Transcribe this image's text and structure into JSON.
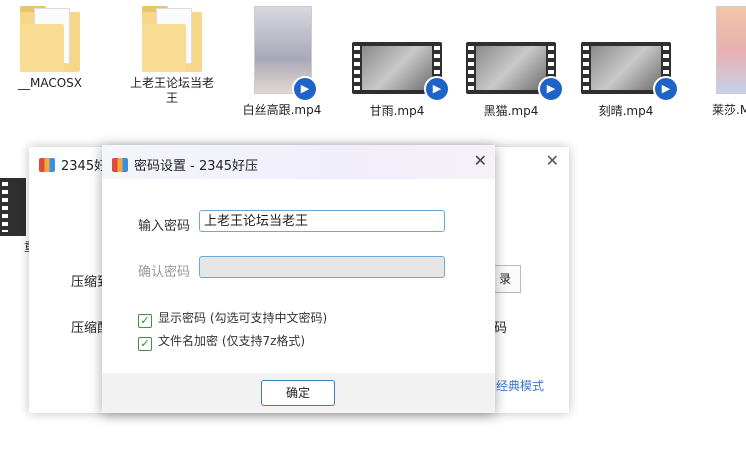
{
  "desktop": {
    "files": [
      {
        "name": "__MACOSX",
        "type": "folder"
      },
      {
        "name": "上老王论坛当老王",
        "type": "folder"
      },
      {
        "name": "白丝高跟.mp4",
        "type": "video-portrait"
      },
      {
        "name": "甘雨.mp4",
        "type": "video"
      },
      {
        "name": "黑猫.mp4",
        "type": "video"
      },
      {
        "name": "刻晴.mp4",
        "type": "video"
      },
      {
        "name": "莱莎.M",
        "type": "video-portrait"
      }
    ],
    "partial_label": "重"
  },
  "back_window": {
    "title": "2345好",
    "close_icon": "✕",
    "label_1": "压缩到",
    "label_2": "压缩配",
    "browse_btn": "录",
    "right_label": "码",
    "classic_mode": "经典模式"
  },
  "dialog": {
    "title": "密码设置 - 2345好压",
    "close_icon": "✕",
    "password_label": "输入密码",
    "password_value": "上老王论坛当老王",
    "confirm_label": "确认密码",
    "confirm_value": "",
    "show_password_label": "显示密码 (勾选可支持中文密码)",
    "encrypt_names_label": "文件名加密 (仅支持7z格式)",
    "show_password_checked": true,
    "encrypt_names_checked": true,
    "ok_button": "确定"
  }
}
